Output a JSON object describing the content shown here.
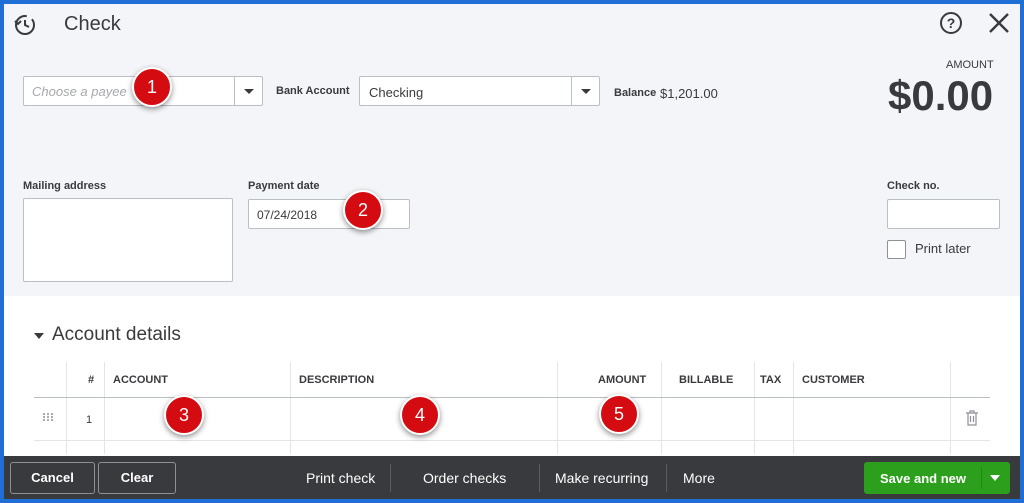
{
  "header": {
    "title": "Check",
    "history_icon": "history-icon",
    "help_icon": "help-icon",
    "close_icon": "close-icon"
  },
  "form": {
    "payee": {
      "value": "",
      "placeholder": "Choose a payee"
    },
    "bank_account": {
      "label": "Bank Account",
      "value": "Checking"
    },
    "balance": {
      "label": "Balance",
      "value": "$1,201.00"
    },
    "amount": {
      "label": "AMOUNT",
      "value": "$0.00"
    },
    "mailing_address": {
      "label": "Mailing address",
      "value": ""
    },
    "payment_date": {
      "label": "Payment date",
      "value": "07/24/2018"
    },
    "check_no": {
      "label": "Check no.",
      "value": ""
    },
    "print_later": {
      "label": "Print later",
      "checked": false
    }
  },
  "account_details": {
    "title": "Account details",
    "columns": [
      "#",
      "ACCOUNT",
      "DESCRIPTION",
      "AMOUNT",
      "BILLABLE",
      "TAX",
      "CUSTOMER"
    ],
    "rows": [
      {
        "num": "1",
        "account": "",
        "description": "",
        "amount": "",
        "billable": "",
        "tax": "",
        "customer": ""
      }
    ]
  },
  "callouts": [
    "1",
    "2",
    "3",
    "4",
    "5"
  ],
  "footer": {
    "cancel": "Cancel",
    "clear": "Clear",
    "print_check": "Print check",
    "order_checks": "Order checks",
    "make_recurring": "Make recurring",
    "more": "More",
    "save_and_new": "Save and new"
  },
  "colors": {
    "frame": "#1f6fd6",
    "callout": "#d40c12",
    "footer_bg": "#393a3d",
    "primary_button": "#2ca01c"
  }
}
